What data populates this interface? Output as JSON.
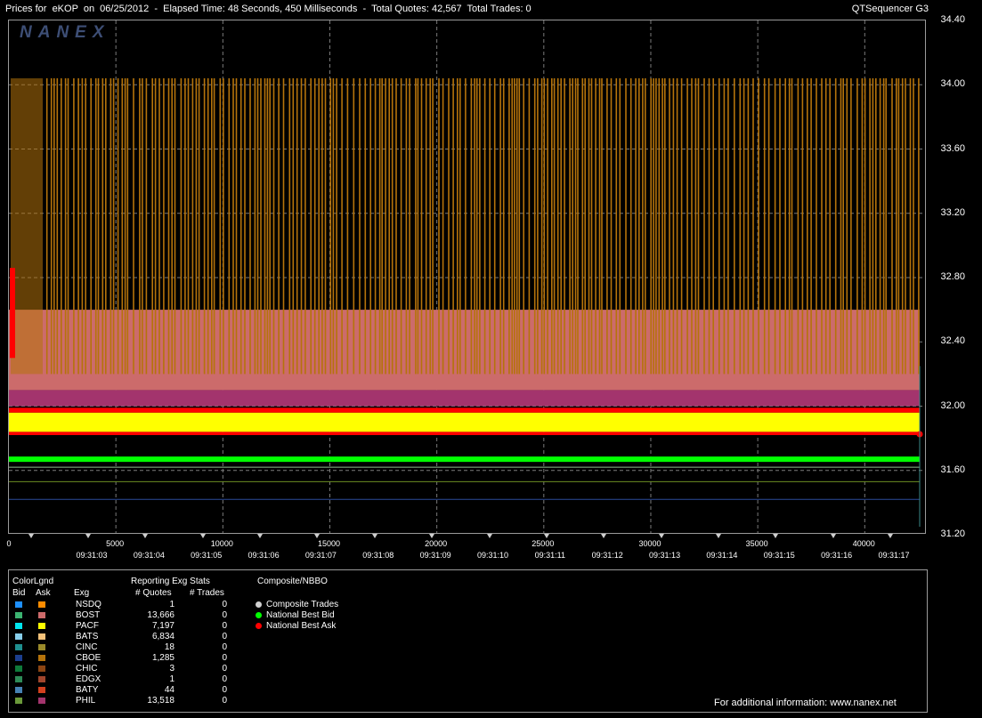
{
  "window": {
    "title": "Prices for  eKOP  on  06/25/2012  -  Elapsed Time: 48 Seconds, 450 Milliseconds  -  Total Quotes: 42,567  Total Trades: 0",
    "app_name": "QTSequencer G3"
  },
  "logo_text": "NANEX",
  "chart_data": {
    "type": "line",
    "ylim": [
      31.2,
      34.4
    ],
    "y_ticks": [
      "34.40",
      "34.00",
      "33.60",
      "33.20",
      "32.80",
      "32.40",
      "32.00",
      "31.60",
      "31.20"
    ],
    "xlim": [
      0,
      42567
    ],
    "x_ticks": [
      0,
      5000,
      10000,
      15000,
      20000,
      25000,
      30000,
      35000,
      40000
    ],
    "x_tick_labels": [
      "0",
      "5000",
      "10000",
      "15000",
      "20000",
      "25000",
      "30000",
      "35000",
      "40000"
    ],
    "time_labels": [
      "09:31:03",
      "09:31:04",
      "09:31:05",
      "09:31:06",
      "09:31:07",
      "09:31:08",
      "09:31:09",
      "09:31:10",
      "09:31:11",
      "09:31:12",
      "09:31:13",
      "09:31:14",
      "09:31:15",
      "09:31:16",
      "09:31:17"
    ],
    "grid": true,
    "series": [
      {
        "name": "CBOE Ask",
        "color": "#b5730b",
        "style": "oscillating",
        "low": 32.2,
        "high": 34.04
      },
      {
        "name": "BOST Ask",
        "color": "#cc6b6b",
        "style": "band",
        "low": 32.1,
        "high": 32.6
      },
      {
        "name": "PHIL Ask",
        "color": "#a3346d",
        "style": "band",
        "low": 32.0,
        "high": 32.1
      },
      {
        "name": "PACF Ask",
        "color": "#ffff00",
        "style": "band",
        "low": 31.84,
        "high": 31.96
      },
      {
        "name": "National Best Ask",
        "color": "#ff0000",
        "style": "line",
        "values": [
          31.99,
          31.84,
          31.82
        ]
      },
      {
        "name": "National Best Bid",
        "color": "#00ff00",
        "style": "line",
        "values": [
          31.67
        ]
      },
      {
        "name": "BOST Bid",
        "color": "#8fbc8f",
        "style": "line",
        "values": [
          31.62
        ]
      },
      {
        "name": "PHIL Bid",
        "color": "#6b8e23",
        "style": "line",
        "values": [
          31.53
        ]
      },
      {
        "name": "CBOE Bid",
        "color": "#2a4a9a",
        "style": "line",
        "values": [
          31.42
        ]
      }
    ]
  },
  "legend": {
    "header_colorlgnd": "ColorLgnd",
    "header_bid": "Bid",
    "header_ask": "Ask",
    "header_exg": "Exg",
    "header_reporting": "Reporting Exg Stats",
    "header_quotes": "# Quotes",
    "header_trades": "# Trades",
    "header_composite": "Composite/NBBO",
    "rows": [
      {
        "exg": "NSDQ",
        "bid": "#1e90ff",
        "ask": "#ff8c00",
        "quotes": "1",
        "trades": "0"
      },
      {
        "exg": "BOST",
        "bid": "#3cb371",
        "ask": "#cd6b6b",
        "quotes": "13,666",
        "trades": "0"
      },
      {
        "exg": "PACF",
        "bid": "#00e5ee",
        "ask": "#ffff00",
        "quotes": "7,197",
        "trades": "0"
      },
      {
        "exg": "BATS",
        "bid": "#87ceeb",
        "ask": "#f4c27a",
        "quotes": "6,834",
        "trades": "0"
      },
      {
        "exg": "CINC",
        "bid": "#1f8f8f",
        "ask": "#9a8a2a",
        "quotes": "18",
        "trades": "0"
      },
      {
        "exg": "CBOE",
        "bid": "#1c3f8f",
        "ask": "#b5730b",
        "quotes": "1,285",
        "trades": "0"
      },
      {
        "exg": "CHIC",
        "bid": "#0f7a3a",
        "ask": "#8b4513",
        "quotes": "3",
        "trades": "0"
      },
      {
        "exg": "EDGX",
        "bid": "#2e8b57",
        "ask": "#a0462d",
        "quotes": "1",
        "trades": "0"
      },
      {
        "exg": "BATY",
        "bid": "#4682b4",
        "ask": "#d2401e",
        "quotes": "44",
        "trades": "0"
      },
      {
        "exg": "PHIL",
        "bid": "#6b9a3a",
        "ask": "#a3346d",
        "quotes": "13,518",
        "trades": "0"
      }
    ],
    "composite_items": [
      {
        "label": "Composite Trades",
        "color": "#d0d0d0"
      },
      {
        "label": "National Best Bid",
        "color": "#00ff00"
      },
      {
        "label": "National Best Ask",
        "color": "#ff0000"
      }
    ],
    "footer": "For additional information: www.nanex.net"
  }
}
